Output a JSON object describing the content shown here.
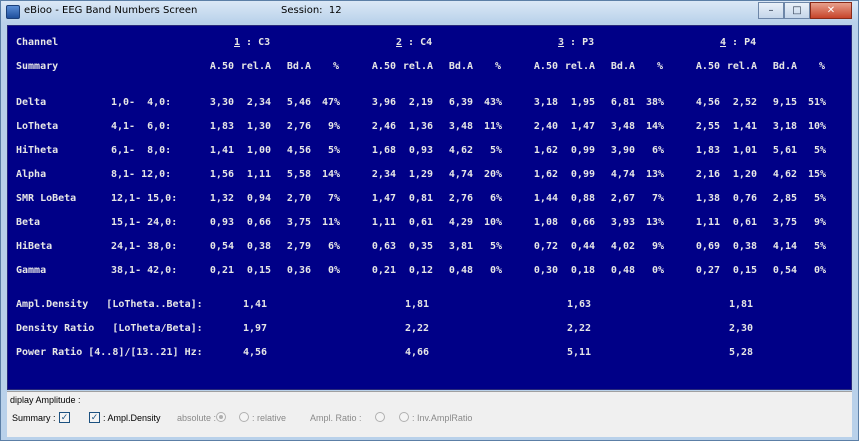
{
  "window": {
    "app_name": "eBioo",
    "title": "- EEG Band Numbers Screen",
    "session_label": "Session:",
    "session_number": "12",
    "minimize_icon": "minimize-icon",
    "maximize_icon": "maximize-icon",
    "close_icon": "close-icon"
  },
  "header": {
    "channel_label": "Channel",
    "summary_label": "Summary",
    "channels": [
      {
        "num": "1",
        "name": " : C3"
      },
      {
        "num": "2",
        "name": " : C4"
      },
      {
        "num": "3",
        "name": " : P3"
      },
      {
        "num": "4",
        "name": " : P4"
      }
    ],
    "columns": [
      "A.50",
      "rel.A",
      "Bd.A",
      "%"
    ]
  },
  "bands": [
    {
      "name": "Delta",
      "range": "1,0-  4,0:",
      "values": [
        [
          "3,30",
          "2,34",
          "5,46",
          "47%"
        ],
        [
          "3,96",
          "2,19",
          "6,39",
          "43%"
        ],
        [
          "3,18",
          "1,95",
          "6,81",
          "38%"
        ],
        [
          "4,56",
          "2,52",
          "9,15",
          "51%"
        ]
      ]
    },
    {
      "name": "LoTheta",
      "range": "4,1-  6,0:",
      "values": [
        [
          "1,83",
          "1,30",
          "2,76",
          "9%"
        ],
        [
          "2,46",
          "1,36",
          "3,48",
          "11%"
        ],
        [
          "2,40",
          "1,47",
          "3,48",
          "14%"
        ],
        [
          "2,55",
          "1,41",
          "3,18",
          "10%"
        ]
      ]
    },
    {
      "name": "HiTheta",
      "range": "6,1-  8,0:",
      "values": [
        [
          "1,41",
          "1,00",
          "4,56",
          "5%"
        ],
        [
          "1,68",
          "0,93",
          "4,62",
          "5%"
        ],
        [
          "1,62",
          "0,99",
          "3,90",
          "6%"
        ],
        [
          "1,83",
          "1,01",
          "5,61",
          "5%"
        ]
      ]
    },
    {
      "name": "Alpha",
      "range": "8,1- 12,0:",
      "values": [
        [
          "1,56",
          "1,11",
          "5,58",
          "14%"
        ],
        [
          "2,34",
          "1,29",
          "4,74",
          "20%"
        ],
        [
          "1,62",
          "0,99",
          "4,74",
          "13%"
        ],
        [
          "2,16",
          "1,20",
          "4,62",
          "15%"
        ]
      ]
    },
    {
      "name": "SMR LoBeta",
      "range": "12,1- 15,0:",
      "values": [
        [
          "1,32",
          "0,94",
          "2,70",
          "7%"
        ],
        [
          "1,47",
          "0,81",
          "2,76",
          "6%"
        ],
        [
          "1,44",
          "0,88",
          "2,67",
          "7%"
        ],
        [
          "1,38",
          "0,76",
          "2,85",
          "5%"
        ]
      ]
    },
    {
      "name": "Beta",
      "range": "15,1- 24,0:",
      "values": [
        [
          "0,93",
          "0,66",
          "3,75",
          "11%"
        ],
        [
          "1,11",
          "0,61",
          "4,29",
          "10%"
        ],
        [
          "1,08",
          "0,66",
          "3,93",
          "13%"
        ],
        [
          "1,11",
          "0,61",
          "3,75",
          "9%"
        ]
      ]
    },
    {
      "name": "HiBeta",
      "range": "24,1- 38,0:",
      "values": [
        [
          "0,54",
          "0,38",
          "2,79",
          "6%"
        ],
        [
          "0,63",
          "0,35",
          "3,81",
          "5%"
        ],
        [
          "0,72",
          "0,44",
          "4,02",
          "9%"
        ],
        [
          "0,69",
          "0,38",
          "4,14",
          "5%"
        ]
      ]
    },
    {
      "name": "Gamma",
      "range": "38,1- 42,0:",
      "values": [
        [
          "0,21",
          "0,15",
          "0,36",
          "0%"
        ],
        [
          "0,21",
          "0,12",
          "0,48",
          "0%"
        ],
        [
          "0,30",
          "0,18",
          "0,48",
          "0%"
        ],
        [
          "0,27",
          "0,15",
          "0,54",
          "0%"
        ]
      ]
    }
  ],
  "ratios": [
    {
      "label": "Ampl.Density   [LoTheta..Beta]:",
      "values": [
        "1,41",
        "1,81",
        "1,63",
        "1,81"
      ]
    },
    {
      "label": "Density Ratio   [LoTheta/Beta]:",
      "values": [
        "1,97",
        "2,22",
        "2,22",
        "2,30"
      ]
    },
    {
      "label": "Power Ratio [4..8]/[13..21] Hz:",
      "values": [
        "4,56",
        "4,66",
        "5,11",
        "5,28"
      ]
    }
  ],
  "controls": {
    "group_title": "diplay Amplitude :",
    "summary_label": "Summary :",
    "summary_checked": true,
    "ampl_density_label": ": Ampl.Density",
    "ampl_density_checked": true,
    "absolute_label": "absolute :",
    "relative_label": ": relative",
    "ampl_ratio_label": "Ampl. Ratio :",
    "inv_ampl_ratio_label": ": Inv.AmplRatio",
    "check_mark": "✓"
  }
}
